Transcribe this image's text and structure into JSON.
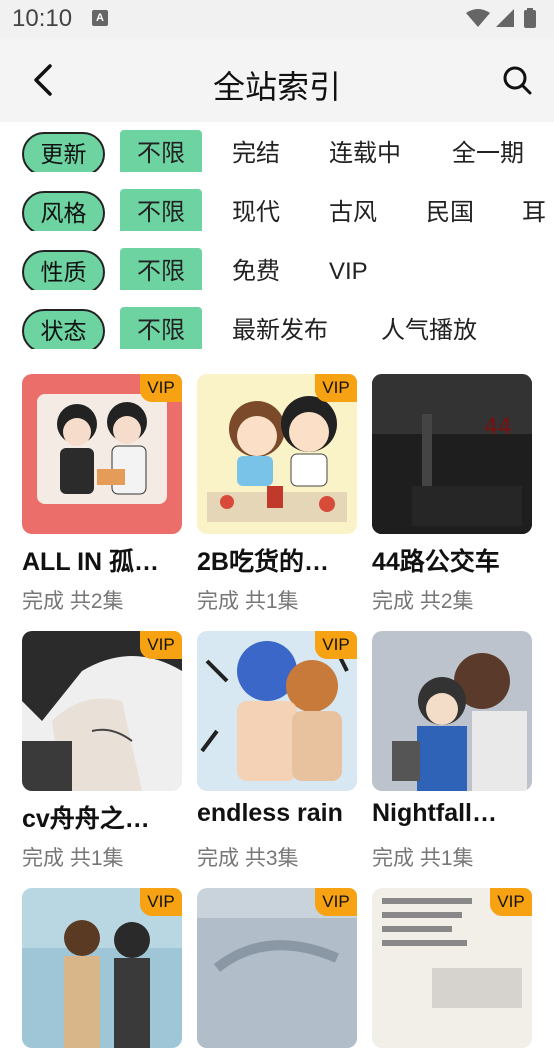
{
  "status_bar": {
    "time": "10:10",
    "notification_letter": "A"
  },
  "header": {
    "title": "全站索引"
  },
  "filters": [
    {
      "label": "更新",
      "options": [
        "不限",
        "完结",
        "连载中",
        "全一期"
      ]
    },
    {
      "label": "风格",
      "options": [
        "不限",
        "现代",
        "古风",
        "民国",
        "耳"
      ]
    },
    {
      "label": "性质",
      "options": [
        "不限",
        "免费",
        "VIP"
      ]
    },
    {
      "label": "状态",
      "options": [
        "不限",
        "最新发布",
        "人气播放"
      ]
    }
  ],
  "colors": {
    "accent": "#6cd3a1",
    "vip_badge": "#f7a212"
  },
  "cards": [
    {
      "title": "ALL IN 孤…",
      "status": "完成",
      "count": "共2集",
      "vip": "VIP"
    },
    {
      "title": "2B吃货的…",
      "status": "完成",
      "count": "共1集",
      "vip": "VIP"
    },
    {
      "title": "44路公交车",
      "status": "完成",
      "count": "共2集",
      "vip": ""
    },
    {
      "title": "cv舟舟之…",
      "status": "完成",
      "count": "共1集",
      "vip": "VIP"
    },
    {
      "title": "endless rain",
      "status": "完成",
      "count": "共3集",
      "vip": "VIP"
    },
    {
      "title": "Nightfall…",
      "status": "完成",
      "count": "共1集",
      "vip": ""
    },
    {
      "title": "",
      "status": "",
      "count": "",
      "vip": "VIP"
    },
    {
      "title": "",
      "status": "",
      "count": "",
      "vip": "VIP"
    },
    {
      "title": "",
      "status": "",
      "count": "",
      "vip": "VIP"
    }
  ]
}
